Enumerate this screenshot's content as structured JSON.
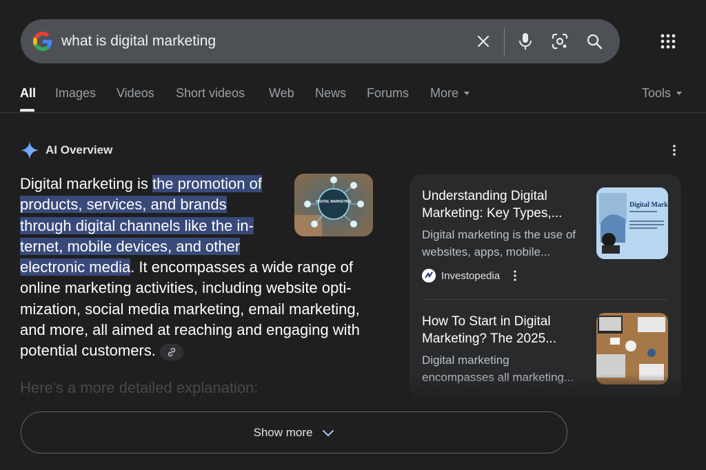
{
  "search": {
    "query": "what is digital marketing"
  },
  "tabs": [
    {
      "label": "All"
    },
    {
      "label": "Images"
    },
    {
      "label": "Videos"
    },
    {
      "label": "Short videos"
    },
    {
      "label": "Web"
    },
    {
      "label": "News"
    },
    {
      "label": "Forums"
    },
    {
      "label": "More"
    }
  ],
  "tools_label": "Tools",
  "ai_overview": {
    "title": "AI Overview",
    "text_lines": {
      "l1_plain": "Digital marketing is ",
      "l1_hl": "the promotion of",
      "l2_hl": "products, services, and brands",
      "l3_hl": "through digital channels like the in-",
      "l4_hl": "ternet, mobile devices, and other",
      "l5_hl": "electronic media",
      "l5_plain": ". It encompasses a wide range of",
      "l6": "online marketing activities, including website opti-",
      "l7": "mization, social media marketing, email marketing,",
      "l8": "and more, all aimed at reaching and engaging with",
      "l9": "potential customers."
    },
    "image_text": "DIGITAL MARKETING",
    "more_detail": "Here's a more detailed explanation:"
  },
  "sources": [
    {
      "title_line1": "Understanding Digital",
      "title_line2": "Marketing: Key Types,...",
      "snippet_line1": "Digital marketing is the use of",
      "snippet_line2": "websites, apps, mobile...",
      "source": "Investopedia",
      "thumb_text": "Digital Mark"
    },
    {
      "title_line1": "How To Start in Digital",
      "title_line2": "Marketing? The 2025...",
      "snippet_line1": "Digital marketing",
      "snippet_line2": "encompasses all marketing..."
    }
  ],
  "show_more_label": "Show more",
  "colors": {
    "background": "#1f1f1f",
    "search_bar": "#4d5156",
    "highlight": "#394a7a",
    "card_bg": "#282a2c"
  }
}
